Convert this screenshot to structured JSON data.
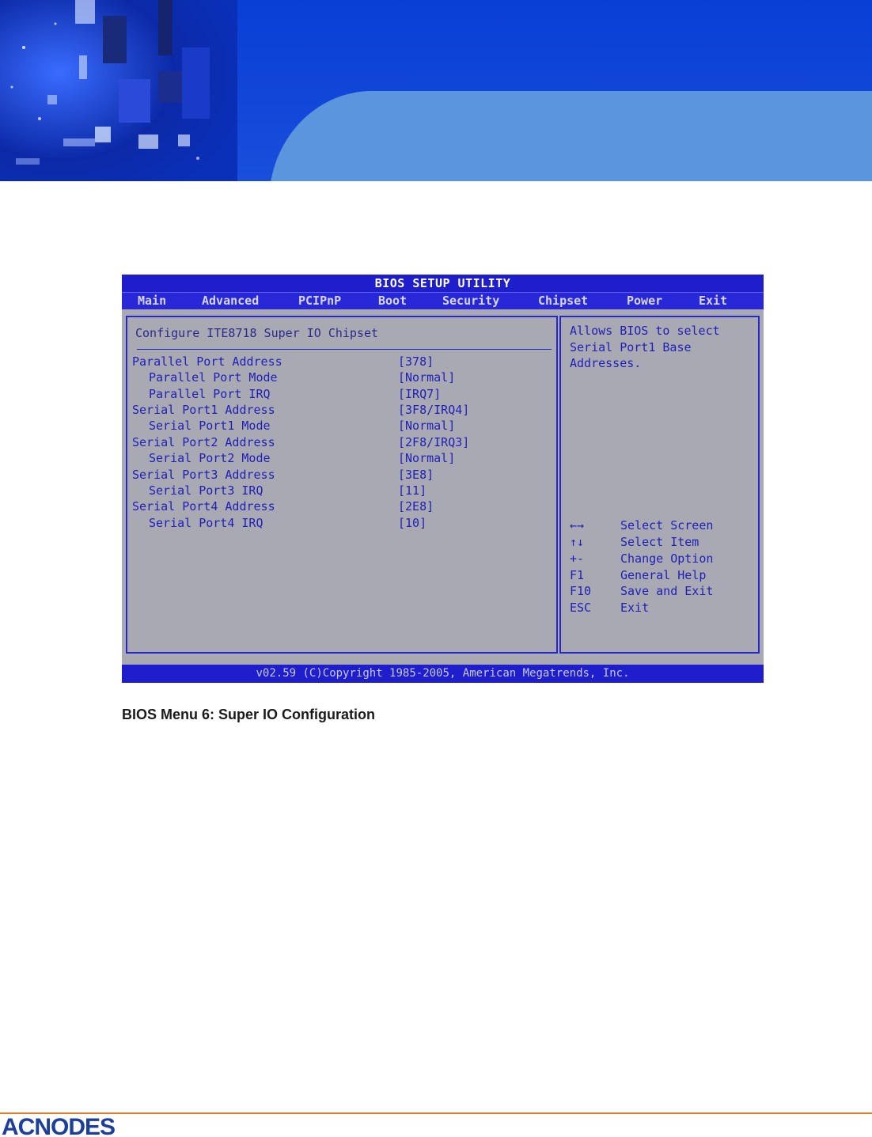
{
  "bios": {
    "title": "BIOS SETUP UTILITY",
    "menu": [
      "Main",
      "Advanced",
      "PCIPnP",
      "Boot",
      "Security",
      "Chipset",
      "Power",
      "Exit"
    ],
    "section_title": "Configure ITE8718 Super IO Chipset",
    "settings": [
      {
        "label": "Parallel Port Address",
        "value": "[378]"
      },
      {
        "label": "Parallel Port Mode",
        "value": "[Normal]"
      },
      {
        "label": "Parallel Port IRQ",
        "value": "[IRQ7]"
      },
      {
        "label": "Serial Port1 Address",
        "value": "[3F8/IRQ4]"
      },
      {
        "label": "Serial Port1 Mode",
        "value": "[Normal]"
      },
      {
        "label": "Serial Port2 Address",
        "value": "[2F8/IRQ3]"
      },
      {
        "label": "Serial Port2 Mode",
        "value": "[Normal]"
      },
      {
        "label": "Serial Port3 Address",
        "value": "[3E8]"
      },
      {
        "label": "Serial Port3 IRQ",
        "value": "[11]"
      },
      {
        "label": "Serial Port4 Address",
        "value": "[2E8]"
      },
      {
        "label": "Serial Port4 IRQ",
        "value": "[10]"
      }
    ],
    "help_text": [
      "Allows BIOS to select",
      "Serial Port1 Base",
      "Addresses."
    ],
    "keys": [
      {
        "key": "←→",
        "action": "Select Screen"
      },
      {
        "key": "↑↓",
        "action": "Select Item"
      },
      {
        "key": "+-",
        "action": "Change Option"
      },
      {
        "key": "F1",
        "action": "General Help"
      },
      {
        "key": "F10",
        "action": "Save and Exit"
      },
      {
        "key": "ESC",
        "action": "Exit"
      }
    ],
    "footer": "v02.59 (C)Copyright 1985-2005, American Megatrends, Inc."
  },
  "caption": "BIOS Menu 6: Super IO Configuration",
  "logo_text": "ACNODES",
  "colors": {
    "banner_blue": "#1247d9",
    "banner_light": "#5b95dd",
    "bios_blue": "#1e1ecc",
    "bios_gray": "#a9a9b4",
    "bios_text": "#1f1fb8",
    "accent_orange": "#e07a2c"
  }
}
